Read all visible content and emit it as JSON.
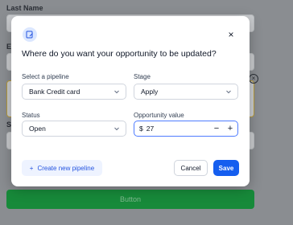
{
  "background": {
    "last_name_label": "Last Name",
    "email_label_fragment": "E",
    "phone_label_fragment": "P",
    "status_label_fragment": "St",
    "button_label": "Button"
  },
  "modal": {
    "title": "Where do you want your opportunity to be updated?",
    "pipeline": {
      "label": "Select a pipeline",
      "value": "Bank Credit card"
    },
    "stage": {
      "label": "Stage",
      "value": "Apply"
    },
    "status": {
      "label": "Status",
      "value": "Open"
    },
    "opportunity_value": {
      "label": "Opportunity value",
      "currency": "$",
      "value": "27",
      "minus": "−",
      "plus": "+"
    },
    "create_pipeline_label": "Create new pipeline",
    "create_pipeline_icon": "+",
    "cancel_label": "Cancel",
    "save_label": "Save",
    "close_icon": "×"
  },
  "colors": {
    "primary": "#155eef",
    "accent_bg": "#eef3ff",
    "green_button": "#178a3a"
  }
}
